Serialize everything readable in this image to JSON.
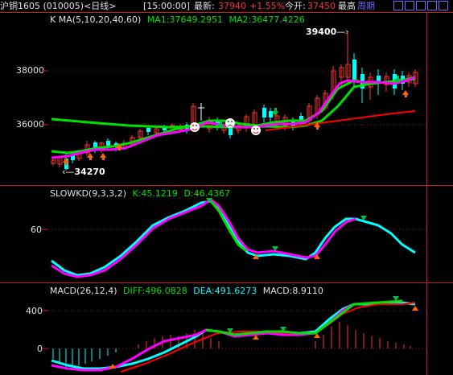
{
  "header": {
    "symbol": "沪铜1605 (010005)<日线>",
    "time": "[15:00:00]",
    "latest_label": "最新:",
    "latest_value": "37940",
    "change": "+1.55%",
    "open_label": "今开:",
    "open_value": "37450",
    "high_label": "最高",
    "period_label": "周期"
  },
  "main_panel": {
    "title": "K  MA(5,10,20,40,60)",
    "ma1": "MA1:37649.2951",
    "ma2": "MA2:36477.4226",
    "high_mark": "39400",
    "low_mark": "34270",
    "price_38000": "38000",
    "price_36000": "36000"
  },
  "kd_panel": {
    "title": "SLOWKD(9,3,3,2)",
    "k": "K:45.1219",
    "d": "D:46.4367",
    "level_60": "60"
  },
  "macd_panel": {
    "title": "MACD(26,12,4)",
    "diff": "DIFF:496.0828",
    "dea": "DEA:491.6273",
    "macd": "MACD:8.9110",
    "level_400": "400",
    "level_0": "0"
  },
  "colors": {
    "up": "#ff3232",
    "down": "#00ffff",
    "ma_green": "#00e000",
    "ma_magenta": "#ff00ff",
    "ma_red": "#ff0000",
    "kd_cyan": "#00ffff",
    "separator": "#c81e1e"
  }
}
